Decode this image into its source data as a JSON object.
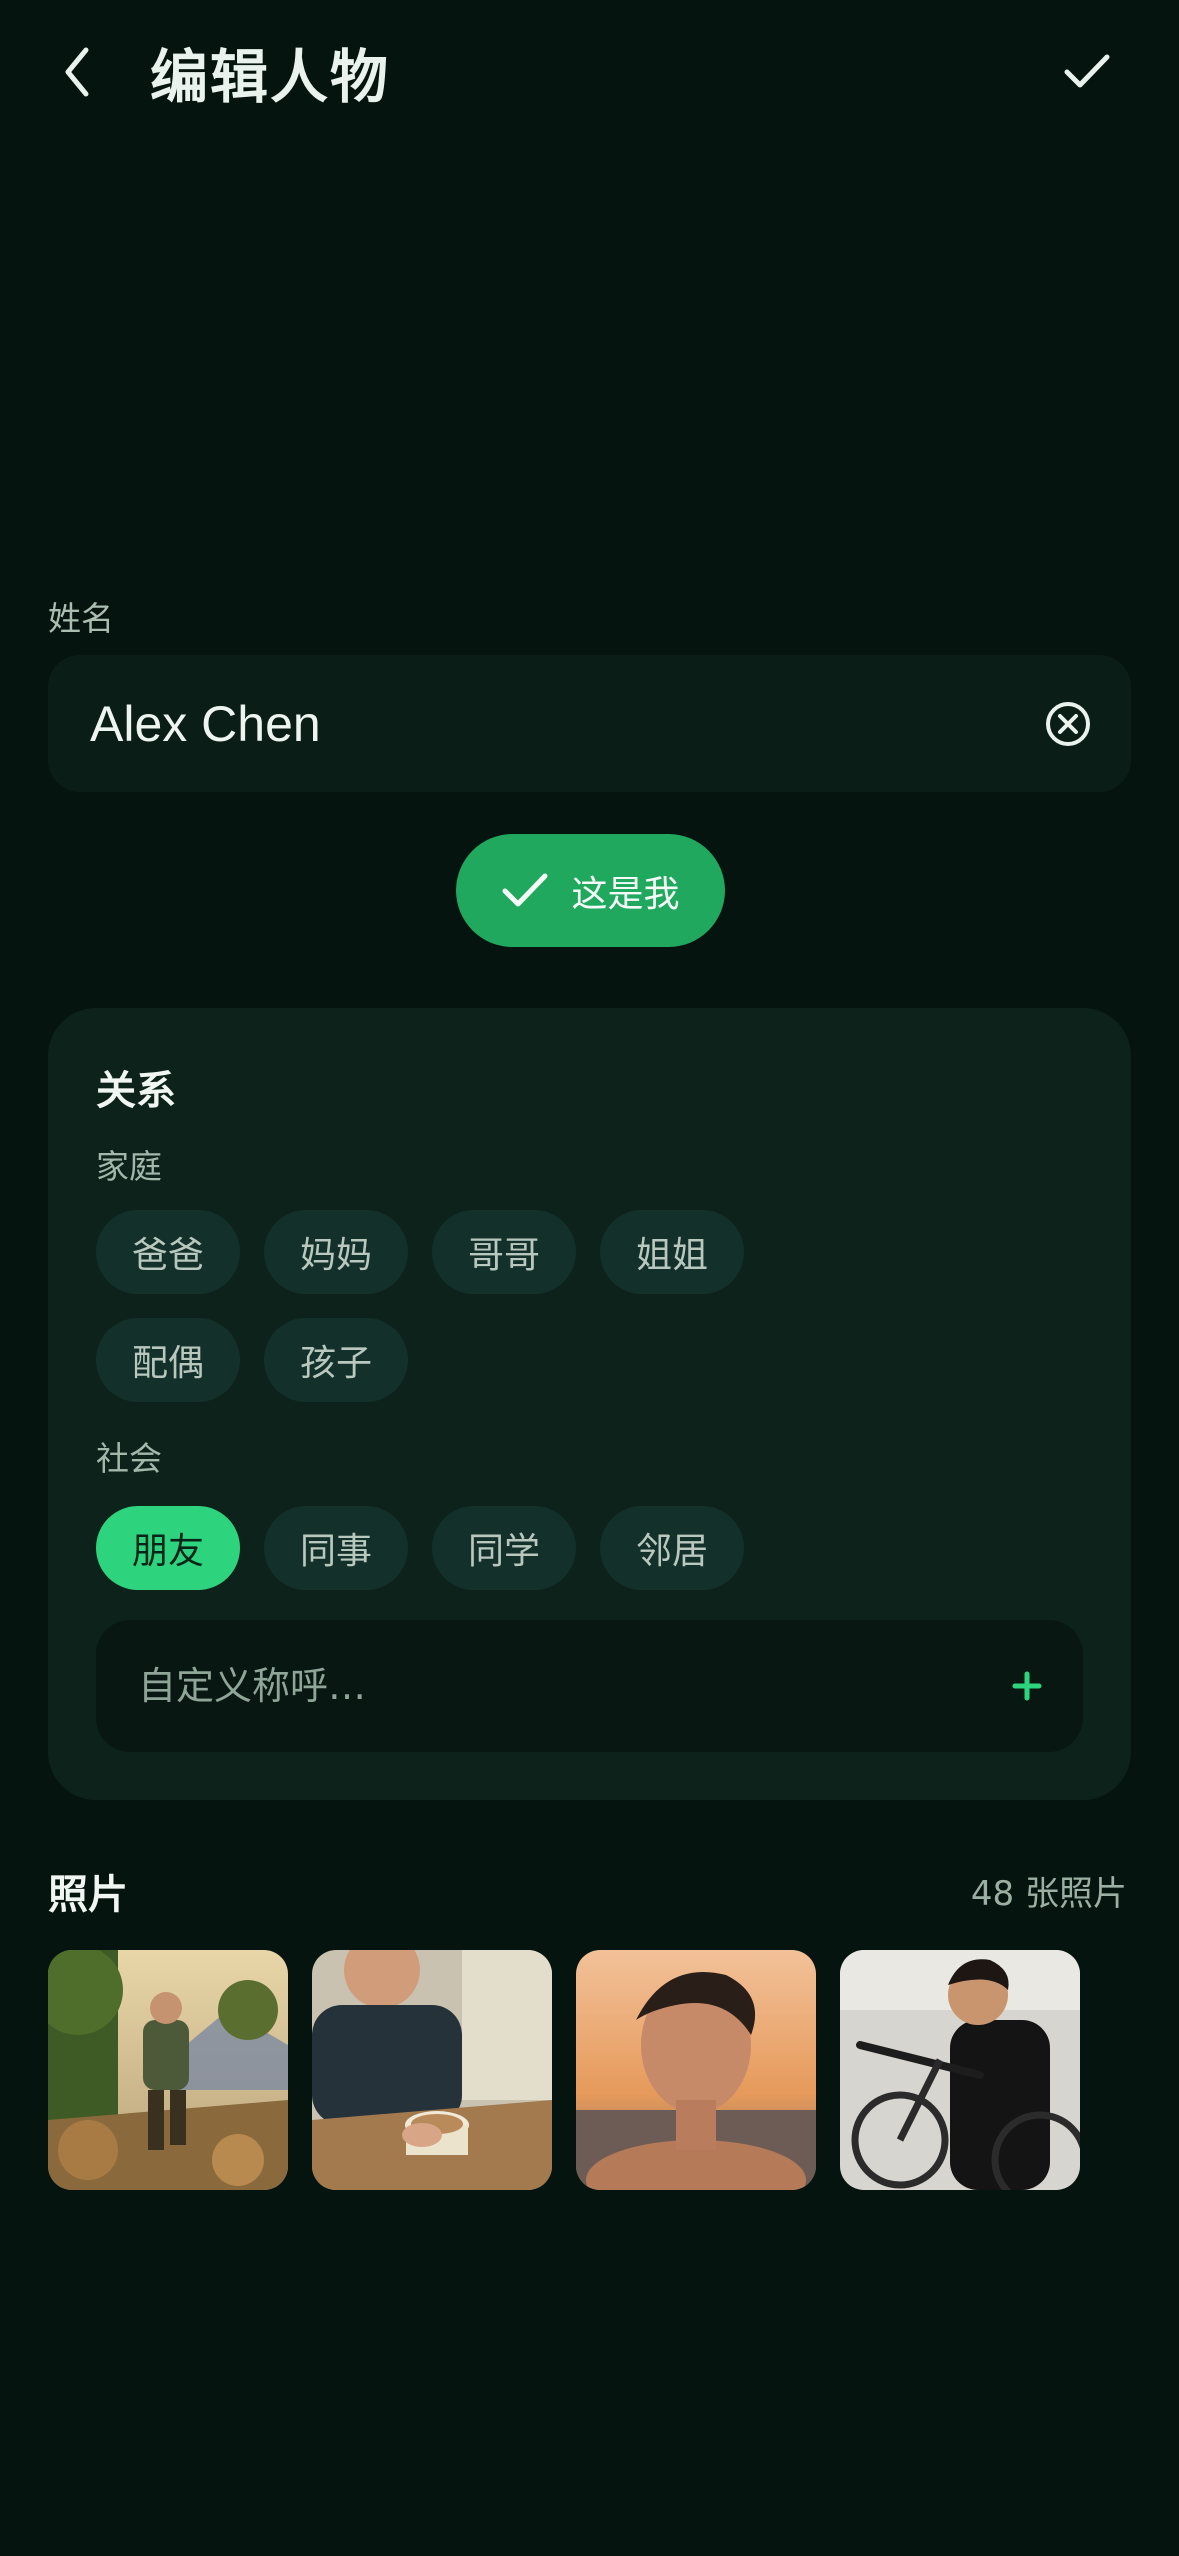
{
  "header": {
    "title": "编辑人物",
    "back_icon": "chevron-left-icon",
    "confirm_icon": "check-icon"
  },
  "name": {
    "label": "姓名",
    "value": "Alex Chen",
    "clear_icon": "clear-circle-icon"
  },
  "me_button": {
    "label": "这是我",
    "icon": "check-icon"
  },
  "relationship": {
    "title": "关系",
    "groups": [
      {
        "label": "家庭",
        "chips": [
          "爸爸",
          "妈妈",
          "哥哥",
          "姐姐",
          "配偶",
          "孩子"
        ]
      },
      {
        "label": "社会",
        "chips": [
          "朋友",
          "同事",
          "同学",
          "邻居"
        ],
        "selected": "朋友"
      }
    ],
    "custom": {
      "placeholder": "自定义称呼…",
      "add_icon": "plus-icon"
    }
  },
  "photos": {
    "title": "照片",
    "count": "48 张照片",
    "thumbnails": [
      "hiking-photo",
      "coffee-photo",
      "beach-sunset-photo",
      "bicycle-photo"
    ]
  },
  "colors": {
    "background": "#061410",
    "accent": "#2ed47d",
    "button_green": "#21a85f",
    "card": "#0d221b"
  }
}
